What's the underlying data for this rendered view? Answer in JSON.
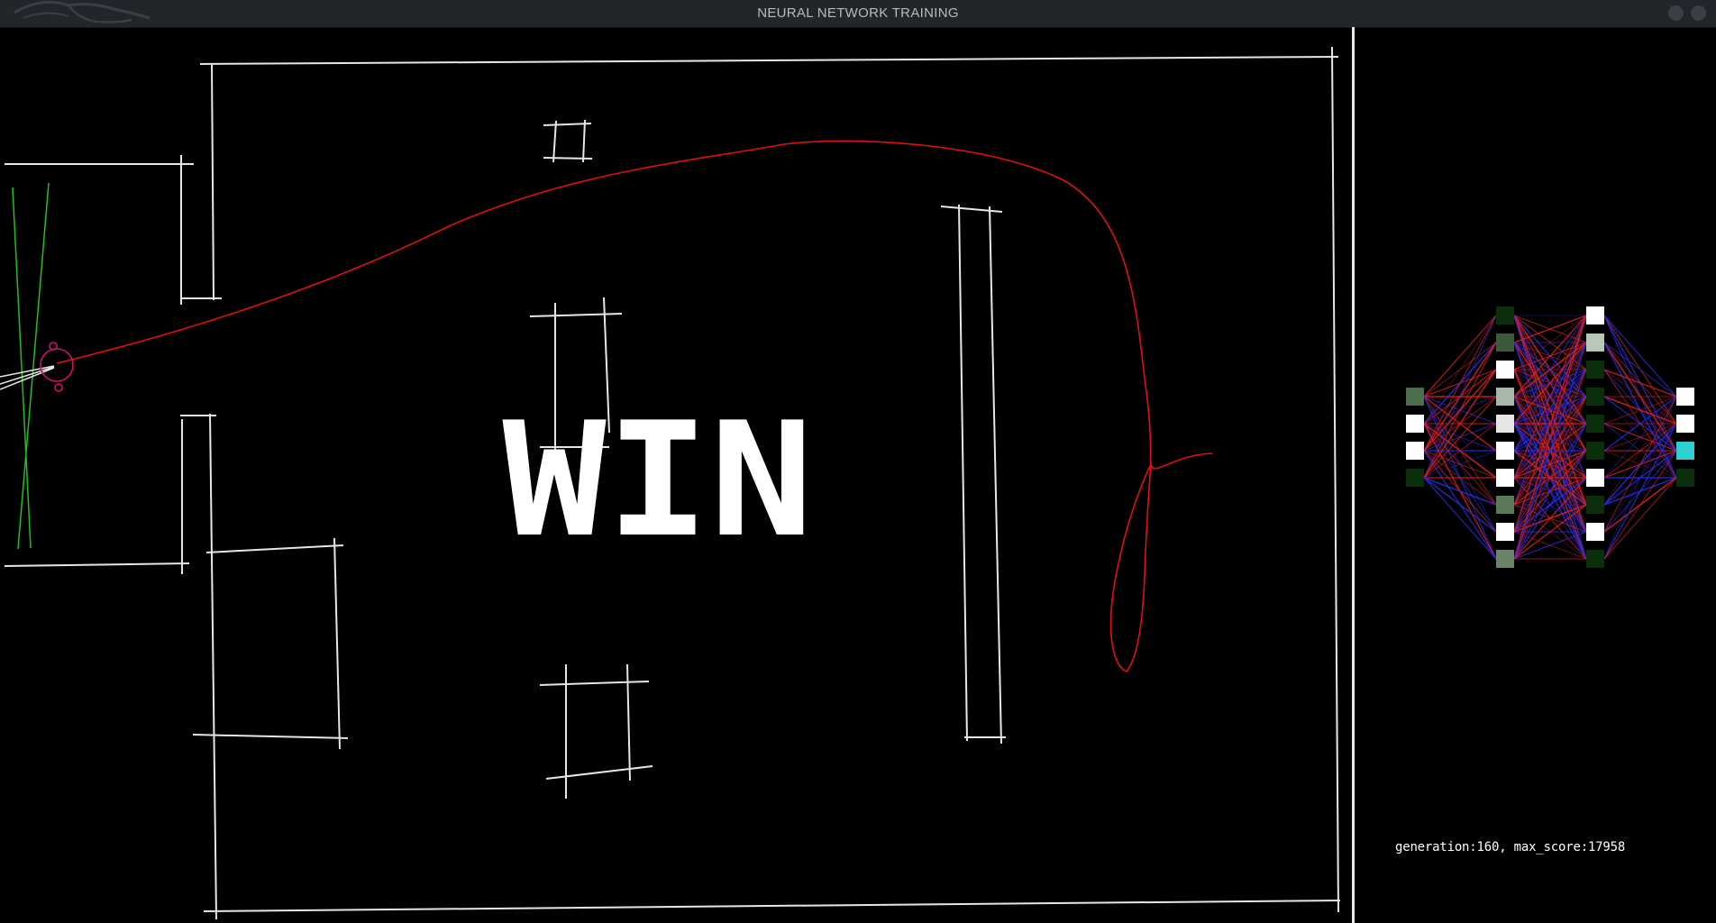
{
  "window": {
    "title": "NEURAL NETWORK TRAINING",
    "logo_icon": "dragon-logo-icon",
    "controls": [
      "minimize-icon",
      "close-icon"
    ]
  },
  "game": {
    "banner_text": "WIN",
    "banner_color": "#ffffff",
    "wall_color": "#e6e6e6",
    "path_color": "#e01010",
    "agent_color": "#d0106a",
    "sensor_color": "#20c020"
  },
  "network": {
    "layer_sizes": [
      4,
      10,
      10,
      4
    ],
    "positive_weight_color": "#2a2ae0",
    "negative_weight_color": "#e02020",
    "active_output_color": "#2ecfcf"
  },
  "status": {
    "text": "generation:160, max_score:17958",
    "generation": 160,
    "max_score": 17958
  }
}
